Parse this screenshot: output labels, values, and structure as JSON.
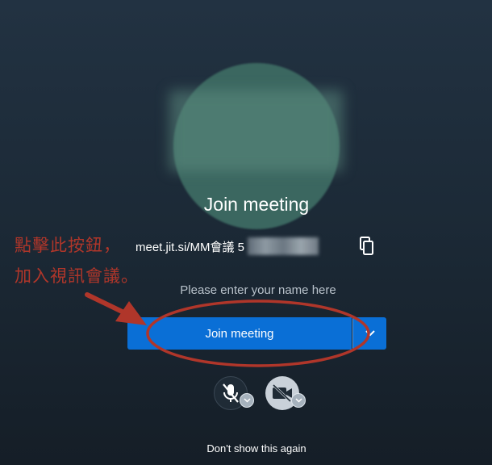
{
  "prejoin": {
    "title": "Join meeting",
    "meeting_url": "meet.jit.si/MM會議 5",
    "name_placeholder": "Please enter your name here",
    "join_button_label": "Join meeting",
    "dont_show_again": "Don't show this again"
  },
  "annotation": {
    "line1": "點擊此按鈕，",
    "line2": "加入視訊會議。"
  },
  "icons": {
    "copy": "copy-icon",
    "join_options": "chevron-down-icon",
    "mic": "microphone-muted-icon",
    "camera": "camera-off-icon"
  },
  "colors": {
    "accent": "#0a6fd6",
    "annotation": "#b0362a",
    "background": "#1c2a37"
  }
}
